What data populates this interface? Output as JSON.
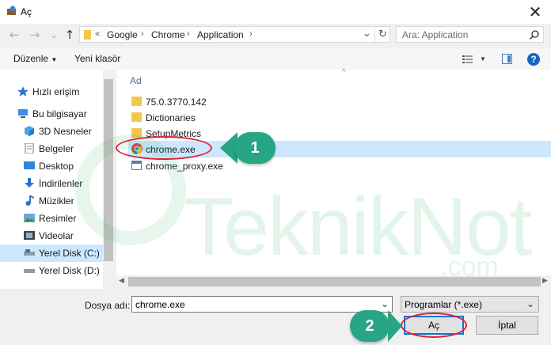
{
  "window": {
    "title": "Aç",
    "close_glyph": "✕"
  },
  "nav": {
    "back_glyph": "←",
    "forward_glyph": "→",
    "recent_glyph": "⌄",
    "up_glyph": "↑"
  },
  "address": {
    "overflow": "«",
    "parts": [
      "Google",
      "Chrome",
      "Application"
    ],
    "sep": "›",
    "refresh_glyph": "↻",
    "dropdown_glyph": "⌄"
  },
  "search": {
    "placeholder": "Ara: Application",
    "icon": "search-icon"
  },
  "toolbar": {
    "organize_label": "Düzenle",
    "new_folder_label": "Yeni klasör",
    "help_glyph": "?"
  },
  "sidebar": {
    "items": [
      {
        "label": "Hızlı erişim",
        "icon": "star-icon"
      },
      {
        "label": "Bu bilgisayar",
        "icon": "computer-icon"
      },
      {
        "label": "3D Nesneler",
        "icon": "cube-icon"
      },
      {
        "label": "Belgeler",
        "icon": "document-icon"
      },
      {
        "label": "Desktop",
        "icon": "desktop-icon"
      },
      {
        "label": "İndirilenler",
        "icon": "download-icon"
      },
      {
        "label": "Müzikler",
        "icon": "music-icon"
      },
      {
        "label": "Resimler",
        "icon": "picture-icon"
      },
      {
        "label": "Videolar",
        "icon": "video-icon"
      },
      {
        "label": "Yerel Disk (C:)",
        "icon": "drive-icon",
        "selected": true
      },
      {
        "label": "Yerel Disk (D:)",
        "icon": "drive-icon"
      }
    ]
  },
  "filelist": {
    "column_header": "Ad",
    "files": [
      {
        "name": "75.0.3770.142",
        "type": "folder"
      },
      {
        "name": "Dictionaries",
        "type": "folder"
      },
      {
        "name": "SetupMetrics",
        "type": "folder"
      },
      {
        "name": "chrome.exe",
        "type": "chrome-exe",
        "selected": true
      },
      {
        "name": "chrome_proxy.exe",
        "type": "exe"
      }
    ]
  },
  "bottom": {
    "filename_label": "Dosya adı:",
    "filename_value": "chrome.exe",
    "filetype_value": "Programlar (*.exe)",
    "open_label": "Aç",
    "cancel_label": "İptal"
  },
  "annotations": {
    "step1": "1",
    "step2": "2"
  },
  "watermark": {
    "main": "TeknikNot",
    "suffix": ".com"
  },
  "colors": {
    "accent": "#0078d7",
    "selection": "#cce8ff",
    "callout": "#27a585",
    "ring": "#e0223c",
    "folder": "#f3c74b"
  }
}
